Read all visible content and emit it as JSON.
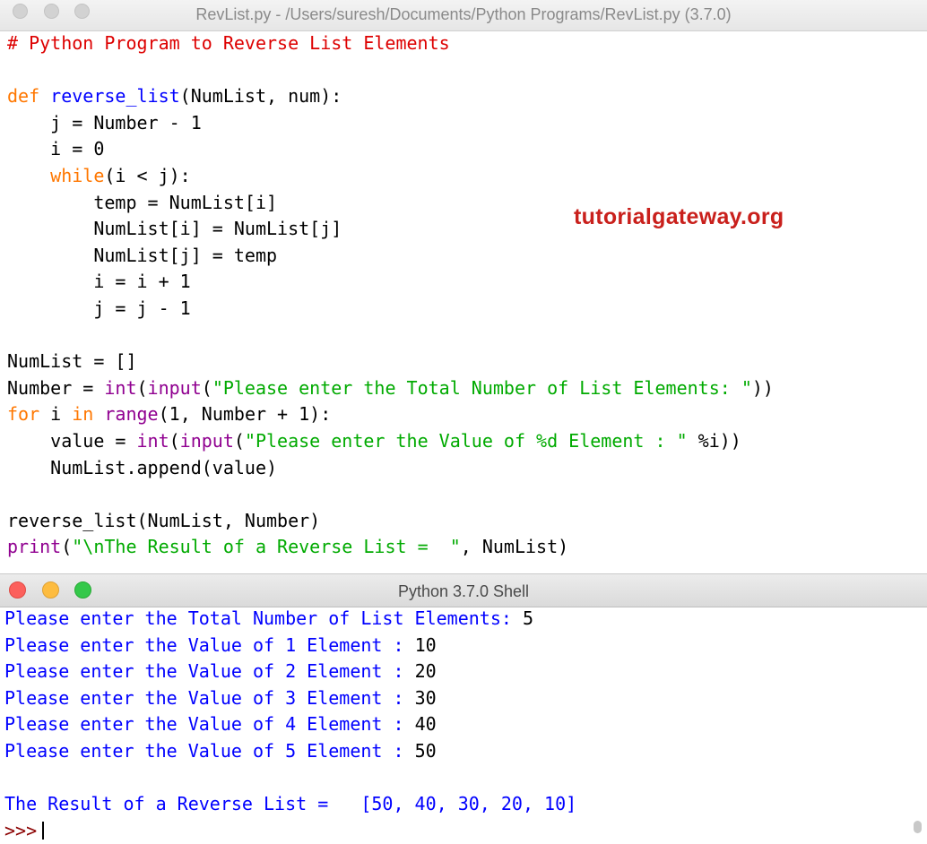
{
  "editor": {
    "title": "RevList.py - /Users/suresh/Documents/Python Programs/RevList.py (3.7.0)",
    "code_lines": [
      [
        {
          "t": "# Python Program to Reverse List Elements",
          "c": "cm"
        }
      ],
      [],
      [
        {
          "t": "def",
          "c": "kw"
        },
        {
          "t": " "
        },
        {
          "t": "reverse_list",
          "c": "fn"
        },
        {
          "t": "(NumList, num):"
        }
      ],
      [
        {
          "t": "    j = Number - 1"
        }
      ],
      [
        {
          "t": "    i = 0"
        }
      ],
      [
        {
          "t": "    "
        },
        {
          "t": "while",
          "c": "kw"
        },
        {
          "t": "(i < j):"
        }
      ],
      [
        {
          "t": "        temp = NumList[i]"
        }
      ],
      [
        {
          "t": "        NumList[i] = NumList[j]"
        }
      ],
      [
        {
          "t": "        NumList[j] = temp"
        }
      ],
      [
        {
          "t": "        i = i + 1"
        }
      ],
      [
        {
          "t": "        j = j - 1"
        }
      ],
      [],
      [
        {
          "t": "NumList = []"
        }
      ],
      [
        {
          "t": "Number = "
        },
        {
          "t": "int",
          "c": "bi"
        },
        {
          "t": "("
        },
        {
          "t": "input",
          "c": "bi"
        },
        {
          "t": "("
        },
        {
          "t": "\"Please enter the Total Number of List Elements: \"",
          "c": "str"
        },
        {
          "t": "))"
        }
      ],
      [
        {
          "t": "for",
          "c": "kw"
        },
        {
          "t": " i "
        },
        {
          "t": "in",
          "c": "kw"
        },
        {
          "t": " "
        },
        {
          "t": "range",
          "c": "bi"
        },
        {
          "t": "(1, Number + 1):"
        }
      ],
      [
        {
          "t": "    value = "
        },
        {
          "t": "int",
          "c": "bi"
        },
        {
          "t": "("
        },
        {
          "t": "input",
          "c": "bi"
        },
        {
          "t": "("
        },
        {
          "t": "\"Please enter the Value of %d Element : \"",
          "c": "str"
        },
        {
          "t": " %i))"
        }
      ],
      [
        {
          "t": "    NumList.append(value)"
        }
      ],
      [],
      [
        {
          "t": "reverse_list(NumList, Number)"
        }
      ],
      [
        {
          "t": "print",
          "c": "bi"
        },
        {
          "t": "("
        },
        {
          "t": "\"\\nThe Result of a Reverse List =  \"",
          "c": "str"
        },
        {
          "t": ", NumList)"
        }
      ]
    ]
  },
  "watermark": "tutorialgateway.org",
  "shell": {
    "title": "Python 3.7.0 Shell",
    "lines": [
      {
        "prompt": "Please enter the Total Number of List Elements: ",
        "input": "5"
      },
      {
        "prompt": "Please enter the Value of 1 Element : ",
        "input": "10"
      },
      {
        "prompt": "Please enter the Value of 2 Element : ",
        "input": "20"
      },
      {
        "prompt": "Please enter the Value of 3 Element : ",
        "input": "30"
      },
      {
        "prompt": "Please enter the Value of 4 Element : ",
        "input": "40"
      },
      {
        "prompt": "Please enter the Value of 5 Element : ",
        "input": "50"
      }
    ],
    "result": "The Result of a Reverse List =   [50, 40, 30, 20, 10]",
    "ps1": ">>>"
  },
  "colors": {
    "keyword": "#ff7700",
    "definition": "#0000ff",
    "builtin": "#900090",
    "string": "#00aa00",
    "comment": "#dd0000",
    "shell_output": "#0000ff",
    "watermark": "#c9201c"
  }
}
